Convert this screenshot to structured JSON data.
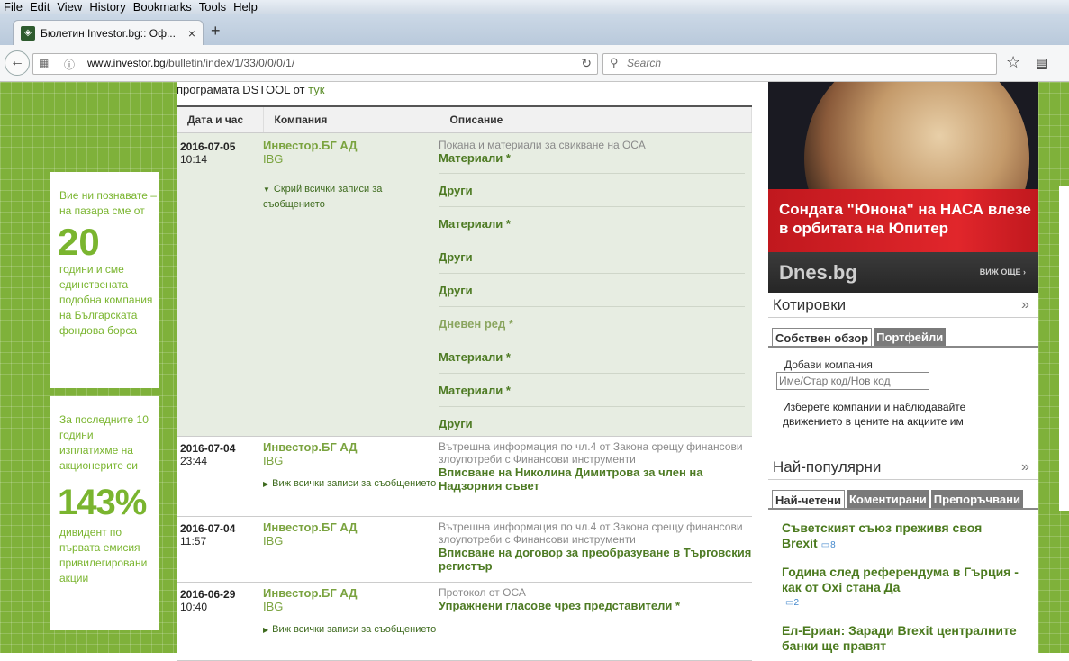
{
  "browser": {
    "menu": [
      "File",
      "Edit",
      "View",
      "History",
      "Bookmarks",
      "Tools",
      "Help"
    ],
    "tab_title": "Бюлетин Investor.bg:: Оф...",
    "tab_close": "×",
    "new_tab": "+",
    "url_host": "www.investor.bg",
    "url_path": "/bulletin/index/1/33/0/0/0/1/",
    "search_placeholder": "Search"
  },
  "page": {
    "intro_text": "програмата DSTOOL от ",
    "intro_link": "тук",
    "columns": [
      "Дата и час",
      "Компания",
      "Описание"
    ],
    "rows": [
      {
        "date": "2016-07-05",
        "time": "10:14",
        "company": "Инвестор.БГ АД",
        "code": "IBG",
        "toggle": "Скрий всички записи за съобщението",
        "category": "Покана и материали за свикване на ОСА",
        "items": [
          "Материали *",
          "Други",
          "Материали *",
          "Други",
          "Други",
          "Дневен ред *",
          "Материали *",
          "Материали *",
          "Други"
        ]
      },
      {
        "date": "2016-07-04",
        "time": "23:44",
        "company": "Инвестор.БГ АД",
        "code": "IBG",
        "toggle": "Виж всички записи за съобщението",
        "category": "Вътрешна информация по чл.4 от Закона срещу финансови злоупотреби с Финансови инструменти",
        "link": "Вписване на Николина Димитрова за член на Надзорния съвет"
      },
      {
        "date": "2016-07-04",
        "time": "11:57",
        "company": "Инвестор.БГ АД",
        "code": "IBG",
        "category": "Вътрешна информация по чл.4 от Закона срещу финансови злоупотреби с Финансови инструменти",
        "link": "Вписване на договор за преобразуване в Търговския регистър"
      },
      {
        "date": "2016-06-29",
        "time": "10:40",
        "company": "Инвестор.БГ АД",
        "code": "IBG",
        "toggle": "Виж всички записи за съобщението",
        "category": "Протокол от ОСА",
        "link": "Упражнени гласове чрез представители *"
      }
    ]
  },
  "promo": {
    "p1_top": "Вие ни познавате – на пазара сме от",
    "p1_big": "20",
    "p1_bottom": "години и сме единствената подобна компания на Българската фондова борса",
    "p2_top": "За последните 10 години изплатихме на акционерите си",
    "p2_big": "143%",
    "p2_bottom": "дивидент по първата емисия привилегировани акции"
  },
  "news": {
    "title": "Сондата \"Юнона\" на НАСА влезе в орбитата на Юпитер",
    "brand": "Dnes.bg",
    "more": "ВИЖ ОЩЕ ›"
  },
  "quotes": {
    "title": "Котировки",
    "tab_own": "Собствен обзор",
    "tab_portfolios": "Портфейли",
    "add_label": "Добави компания",
    "input_placeholder": "Име/Стар код/Нов код",
    "note": "Изберете компании и наблюдавайте движението в цените на акциите им"
  },
  "popular": {
    "title": "Най-популярни",
    "tabs": [
      "Най-четени",
      "Коментирани",
      "Препоръчвани"
    ],
    "items": [
      {
        "title": "Съветският съюз преживя своя Brexit",
        "comments": "8"
      },
      {
        "title": "Година след референдума в Гърция - как от Oxi стана Да",
        "comments": "2"
      },
      {
        "title": "Ел-Ериан: Заради Brexit централните банки ще правят"
      }
    ]
  },
  "colors": {
    "accent_green": "#7fb13a",
    "link_green": "#4e7b24",
    "news_red": "#d8202a"
  }
}
